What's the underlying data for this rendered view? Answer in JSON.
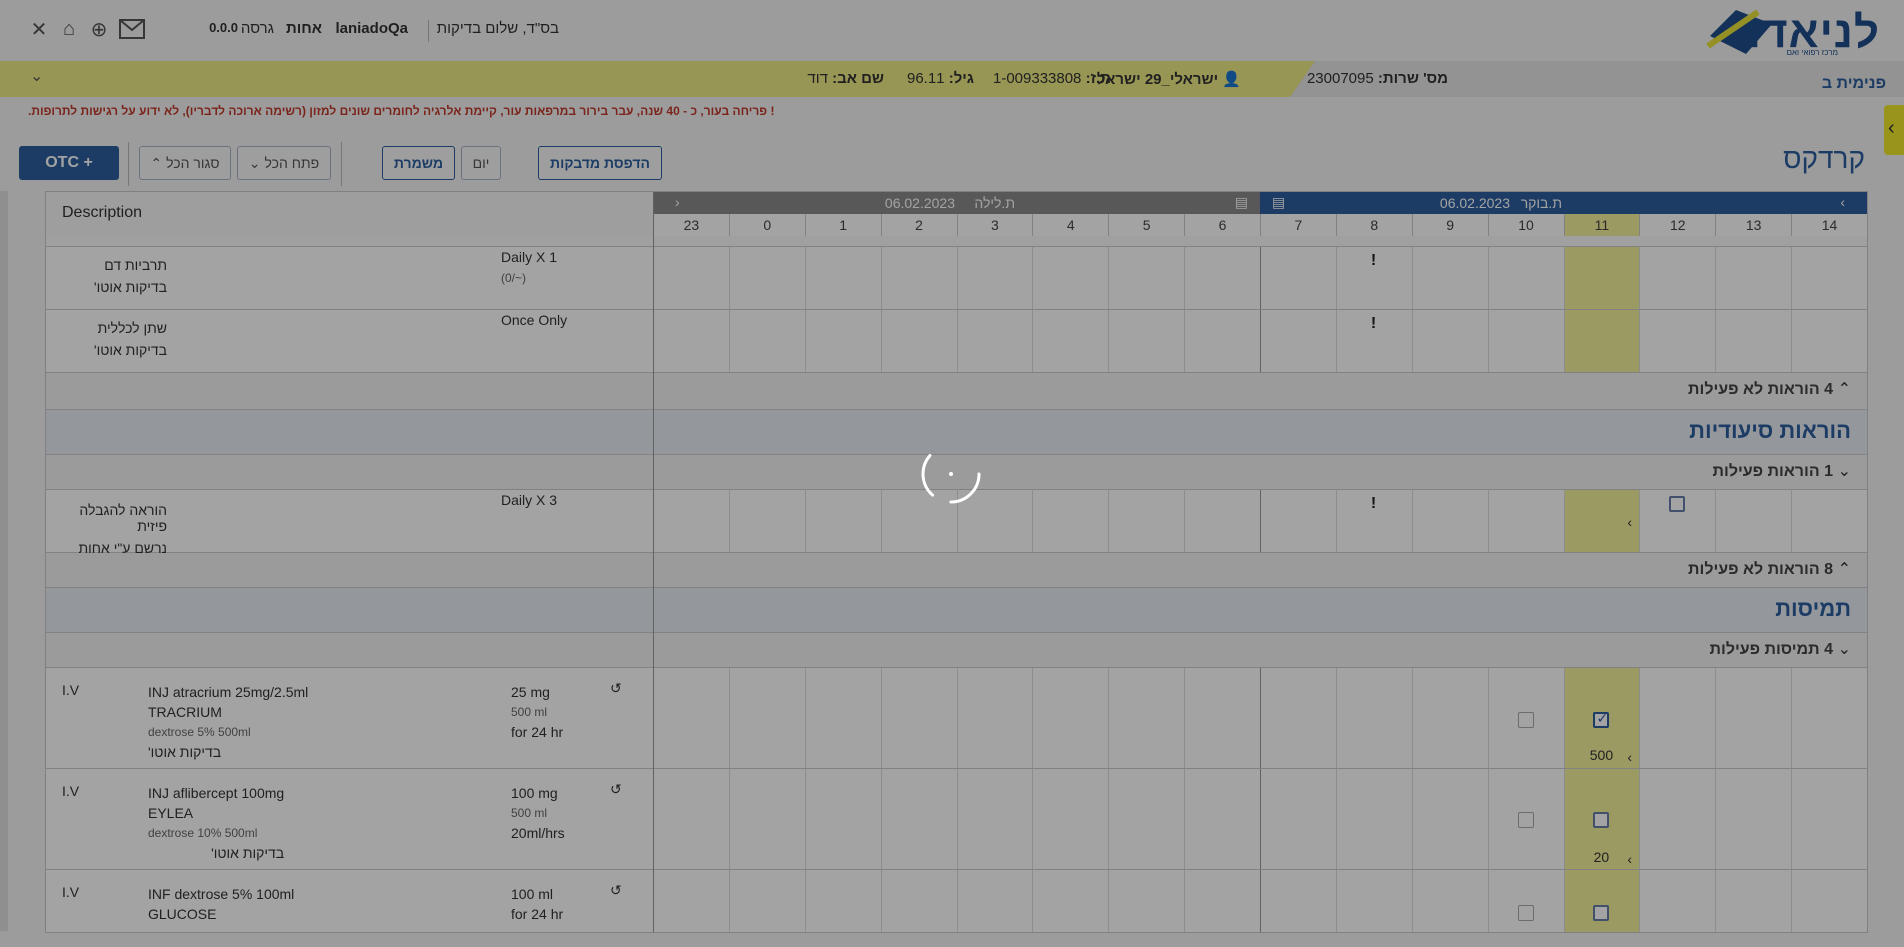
{
  "header": {
    "logo_text": "לניאדו",
    "logo_sub": "מרכז רפואי ואם",
    "greeting": "בס\"ד, שלום",
    "app_name": "בדיקות",
    "user": "laniadoQa",
    "role": "אחות",
    "version_label": "גרסה",
    "version_value": "0.0.0",
    "icons": [
      "close-icon",
      "home-icon",
      "help-icon",
      "mail-icon"
    ]
  },
  "patient": {
    "department": "פנימית ב",
    "service_label": "מס' שרות:",
    "service_value": "23007095",
    "name": "ישראלי_29 ישראל",
    "id_label": "ת.ז:",
    "id_value": "1-009333808",
    "age_label": "גיל:",
    "age_value": "96.11",
    "father_label": "שם אב:",
    "father_value": "דוד"
  },
  "alert": "! פריחה בעור, כ - 40 שנה, עבר בירור במרפאות עור, קיימת אלרגיה לחומרים שונים למזון (רשימה ארוכה לדבריו), לא ידוע על רגישות לתרופות.",
  "toolbar": {
    "title": "קרדקס",
    "print_label": "הדפסת מדבקות",
    "day_label": "יום",
    "shift_label": "משמרת",
    "open_all_label": "פתח הכל",
    "close_all_label": "סגור הכל",
    "otc_label": "OTC +"
  },
  "grid": {
    "description_header": "Description",
    "morning_label": "ת.בוקר",
    "morning_date": "06.02.2023",
    "night_label": "ת.לילה",
    "night_date": "06.02.2023",
    "hours": [
      "23",
      "0",
      "1",
      "2",
      "3",
      "4",
      "5",
      "6",
      "7",
      "8",
      "9",
      "10",
      "11",
      "12",
      "13",
      "14"
    ],
    "current_hour": "11",
    "tests": [
      {
        "name": "תרביות דם",
        "sub": "בדיקות אוטו'",
        "freq": "Daily X 1",
        "freq_sub": "(0/~)",
        "alert_hour": "8"
      },
      {
        "name": "שתן לכללית",
        "sub": "בדיקות אוטו'",
        "freq": "Once Only",
        "freq_sub": "",
        "alert_hour": "8"
      }
    ],
    "inactive_tests": "4 הוראות לא פעילות",
    "nursing_title": "הוראות סיעודיות",
    "nursing_active": "1 הוראות פעילות",
    "nursing": [
      {
        "name": "הוראה להגבלה פיזית",
        "sub": "נרשם ע\"י אחות",
        "freq": "Daily X 3",
        "alert_hour": "8"
      }
    ],
    "nursing_inactive": "8 הוראות לא פעילות",
    "infusions_title": "תמיסות",
    "infusions_active": "4 תמיסות פעילות",
    "infusions": [
      {
        "route": "I.V",
        "name": "INJ atracrium 25mg/2.5ml",
        "brand": "TRACRIUM",
        "diluent": "dextrose 5% 500ml",
        "sub": "בדיקות אוטו'",
        "dose": "25 mg",
        "volume": "500 ml",
        "rate": "for 24 hr",
        "value_at_11": "500",
        "checked": true
      },
      {
        "route": "I.V",
        "name": "INJ aflibercept 100mg",
        "brand": "EYLEA",
        "diluent": "dextrose 10% 500ml",
        "sub": "בדיקות אוטו'",
        "dose": "100 mg",
        "volume": "500 ml",
        "rate": "20ml/hrs",
        "value_at_11": "20",
        "checked": false
      },
      {
        "route": "I.V",
        "name": "INF dextrose 5% 100ml",
        "brand": "GLUCOSE",
        "diluent": "",
        "sub": "",
        "dose": "100 ml",
        "volume": "",
        "rate": "for 24 hr",
        "value_at_11": "",
        "checked": false
      }
    ]
  },
  "colors": {
    "accent": "#2c5f9e",
    "patient_bar": "#eceb86",
    "alert": "#c0392b",
    "current_hour": "#f3f19a",
    "overlay": "rgba(0,0,0,0.36)"
  }
}
